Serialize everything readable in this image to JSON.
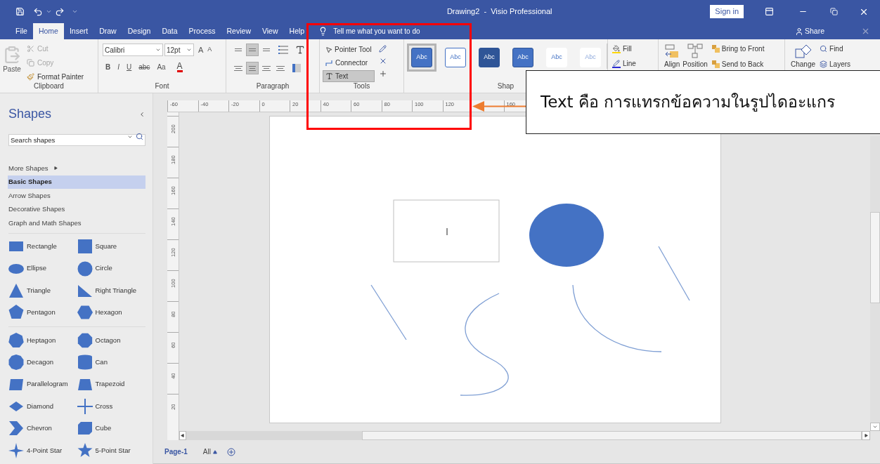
{
  "title_bar": {
    "title": "Drawing2  -  Visio Professional",
    "sign_in": "Sign in"
  },
  "menu_tabs": [
    {
      "label": "File",
      "selected": false
    },
    {
      "label": "Home",
      "selected": true
    },
    {
      "label": "Insert",
      "selected": false
    },
    {
      "label": "Draw",
      "selected": false
    },
    {
      "label": "Design",
      "selected": false
    },
    {
      "label": "Data",
      "selected": false
    },
    {
      "label": "Process",
      "selected": false
    },
    {
      "label": "Review",
      "selected": false
    },
    {
      "label": "View",
      "selected": false
    },
    {
      "label": "Help",
      "selected": false
    }
  ],
  "tell_me": "Tell me what you want to do",
  "share": "Share",
  "ribbon": {
    "clipboard": {
      "label": "Clipboard",
      "paste": {
        "label": "Paste",
        "disabled": true
      },
      "cut": {
        "label": "Cut",
        "disabled": true
      },
      "copy": {
        "label": "Copy",
        "disabled": true
      },
      "format_painter": {
        "label": "Format Painter",
        "disabled": false
      }
    },
    "font": {
      "label": "Font",
      "font_name": "Calibri",
      "font_size": "12pt",
      "size_buttons": [
        "A",
        "A"
      ],
      "styles": [
        "B",
        "I",
        "U",
        "abc",
        "Aa"
      ],
      "color_button": "A"
    },
    "paragraph": {
      "label": "Paragraph",
      "vertical_align": [
        {
          "selected": false
        },
        {
          "selected": true
        },
        {
          "selected": false
        }
      ],
      "horizontal_align": [
        {
          "selected": false
        },
        {
          "selected": true
        },
        {
          "selected": false
        },
        {
          "selected": false
        }
      ]
    },
    "tools": {
      "label": "Tools",
      "items": [
        {
          "kind": "pointer",
          "label": "Pointer Tool",
          "selected": false
        },
        {
          "kind": "connector",
          "label": "Connector",
          "selected": false
        },
        {
          "kind": "text",
          "label": "Text",
          "selected": true
        }
      ]
    },
    "shape_styles": {
      "label": "Shap",
      "swatches": [
        {
          "label": "Abc",
          "selected": true
        },
        {
          "label": "Abc",
          "selected": false
        },
        {
          "label": "Abc",
          "selected": false
        },
        {
          "label": "Abc",
          "selected": false
        },
        {
          "label": "Abc",
          "selected": false
        },
        {
          "label": "Abc",
          "selected": false
        }
      ],
      "fill": "Fill",
      "line": "Line"
    },
    "arrange": {
      "align": "Align",
      "position": "Position",
      "bring_to_front": "Bring to Front",
      "send_to_back": "Send to Back"
    },
    "editing": {
      "change": "Change",
      "find": "Find",
      "layers": "Layers"
    }
  },
  "shapes_panel": {
    "title": "Shapes",
    "search_placeholder": "Search shapes",
    "stencils": [
      {
        "label": "More Shapes",
        "selected": false
      },
      {
        "label": "Basic Shapes",
        "selected": true
      },
      {
        "label": "Arrow Shapes",
        "selected": false
      },
      {
        "label": "Decorative Shapes",
        "selected": false
      },
      {
        "label": "Graph and Math Shapes",
        "selected": false
      }
    ],
    "shape_groups": [
      [
        {
          "kind": "rectangle",
          "label": "Rectangle"
        },
        {
          "kind": "square",
          "label": "Square"
        },
        {
          "kind": "ellipse",
          "label": "Ellipse"
        },
        {
          "kind": "circle",
          "label": "Circle"
        },
        {
          "kind": "triangle",
          "label": "Triangle"
        },
        {
          "kind": "right_triangle",
          "label": "Right Triangle"
        },
        {
          "kind": "pentagon",
          "label": "Pentagon"
        },
        {
          "kind": "hexagon",
          "label": "Hexagon"
        }
      ],
      [
        {
          "kind": "heptagon",
          "label": "Heptagon"
        },
        {
          "kind": "octagon",
          "label": "Octagon"
        },
        {
          "kind": "decagon",
          "label": "Decagon"
        },
        {
          "kind": "can",
          "label": "Can"
        },
        {
          "kind": "parallelogram",
          "label": "Parallelogram"
        },
        {
          "kind": "trapezoid",
          "label": "Trapezoid"
        },
        {
          "kind": "diamond",
          "label": "Diamond"
        },
        {
          "kind": "cross",
          "label": "Cross"
        },
        {
          "kind": "chevron",
          "label": "Chevron"
        },
        {
          "kind": "cube",
          "label": "Cube"
        },
        {
          "kind": "star4",
          "label": "4-Point Star"
        },
        {
          "kind": "star5",
          "label": "5-Point Star"
        }
      ]
    ]
  },
  "ruler": {
    "horizontal": [
      "-60",
      "-40",
      "-20",
      "0",
      "20",
      "40",
      "60",
      "80",
      "100",
      "120",
      "160"
    ],
    "vertical": [
      "200",
      "180",
      "160",
      "140",
      "120",
      "100",
      "80",
      "60",
      "40",
      "20"
    ]
  },
  "page_tabs": [
    {
      "label": "Page-1",
      "selected": true
    },
    {
      "label": "All",
      "selected": false
    }
  ],
  "annotation": {
    "text": "Text คือ การแทรกข้อความในรูปไดอะแกร"
  }
}
